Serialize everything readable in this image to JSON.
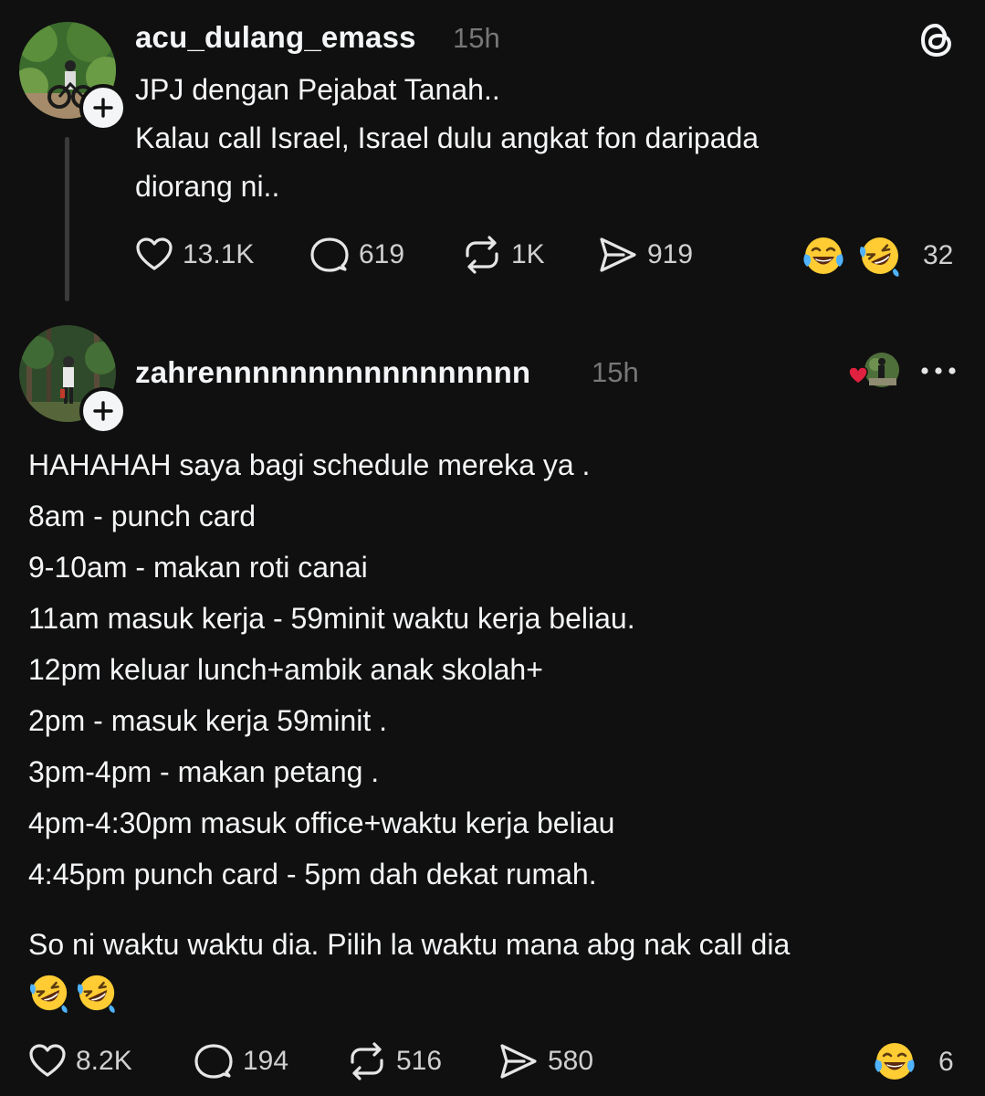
{
  "post1": {
    "username": "acu_dulang_emass",
    "time": "15h",
    "lines": [
      "JPJ dengan Pejabat Tanah..",
      "Kalau call Israel, Israel dulu angkat fon daripada",
      "diorang ni.."
    ],
    "actions": {
      "likes": "13.1K",
      "replies": "619",
      "reposts": "1K",
      "shares": "919"
    },
    "reaction_count": "32",
    "icons": {
      "app": "threads-logo-icon",
      "follow": "plus-icon",
      "reactions": [
        "face-with-tears-of-joy-icon",
        "rolling-on-floor-laughing-icon"
      ]
    }
  },
  "post2": {
    "username": "zahrennnnnnnnnnnnnnnnn",
    "time": "15h",
    "lines": [
      "HAHAHAH saya bagi schedule mereka ya .",
      "8am - punch card",
      "9-10am - makan roti canai",
      "11am masuk kerja - 59minit waktu kerja beliau.",
      "12pm keluar lunch+ambik anak skolah+",
      "2pm - masuk kerja 59minit .",
      "3pm-4pm - makan petang .",
      "4pm-4:30pm masuk office+waktu kerja beliau",
      "4:45pm punch card - 5pm dah dekat rumah."
    ],
    "closing": "So ni waktu waktu dia. Pilih la waktu mana abg nak call dia",
    "actions": {
      "likes": "8.2K",
      "replies": "194",
      "reposts": "516",
      "shares": "580"
    },
    "reaction_count": "6",
    "icons": {
      "liked_by": "liked-by-avatar-icon",
      "more": "more-options-icon",
      "follow": "plus-icon",
      "closing_emoji": [
        "rolling-on-floor-laughing-icon",
        "rolling-on-floor-laughing-icon"
      ],
      "reactions": [
        "face-with-tears-of-joy-icon"
      ]
    }
  },
  "colors": {
    "background": "#101010",
    "text": "#f3f5f7",
    "secondary": "#777777",
    "heart": "#e0213f"
  }
}
